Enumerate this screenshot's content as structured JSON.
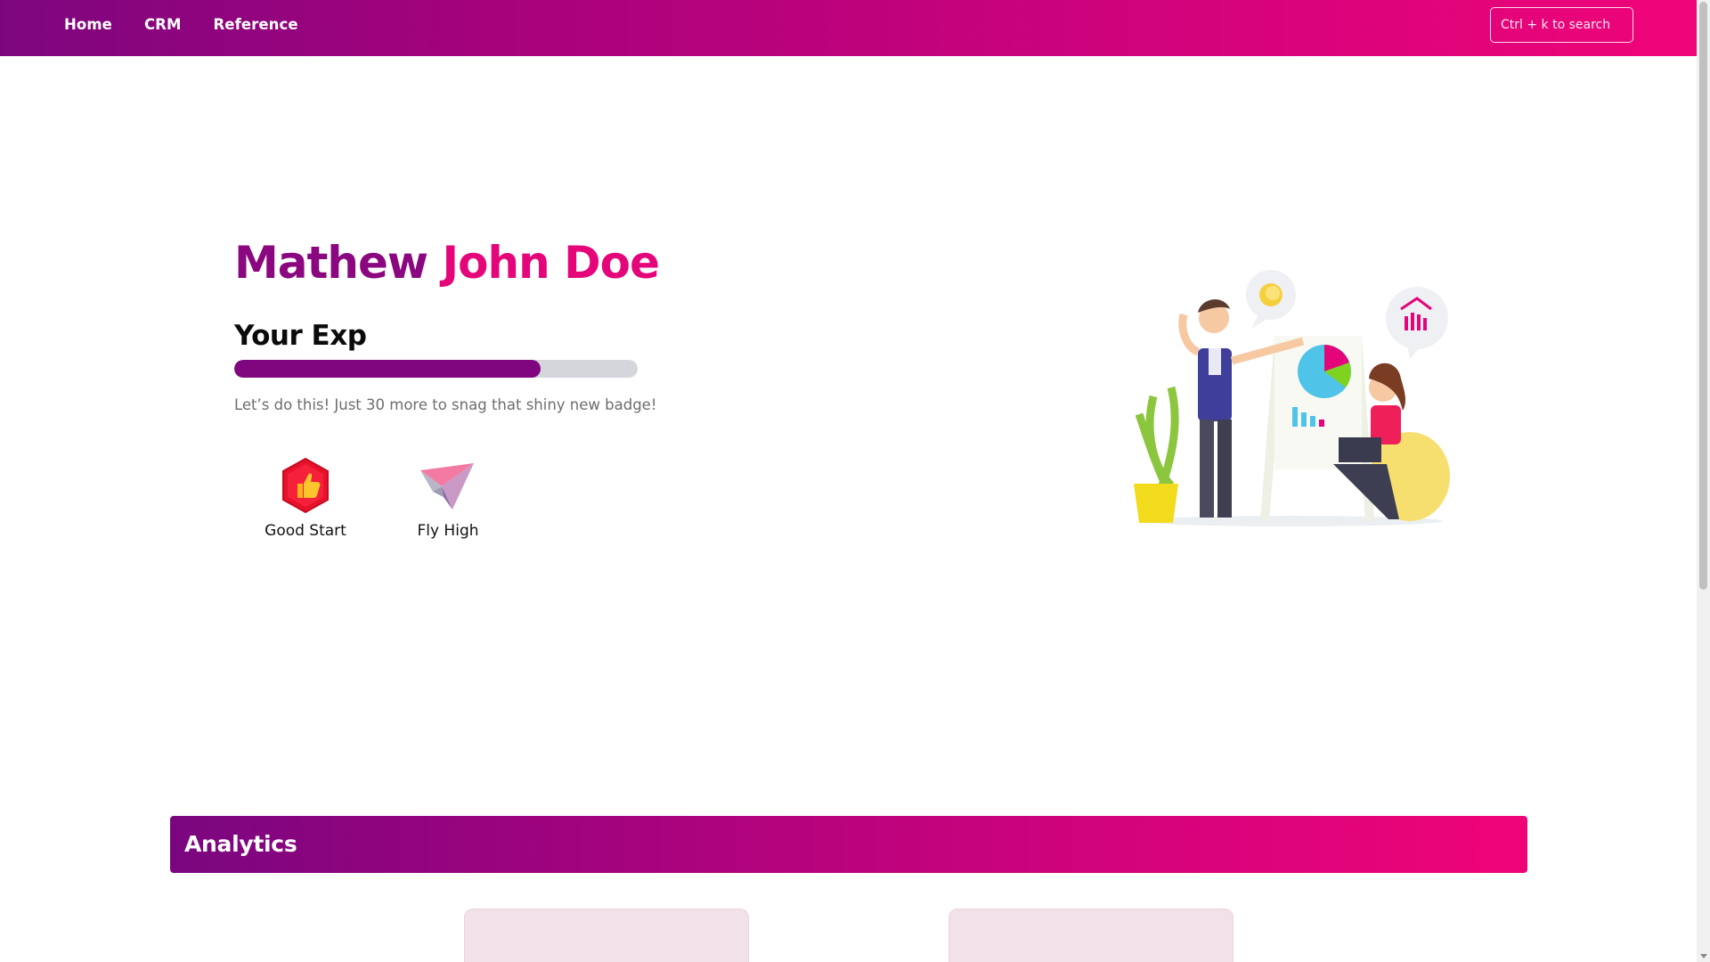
{
  "nav": {
    "items": [
      {
        "label": "Home"
      },
      {
        "label": "CRM"
      },
      {
        "label": "Reference"
      }
    ],
    "search_placeholder": "Ctrl + k to search"
  },
  "hero": {
    "first_name": "Mathew",
    "last_name": "John Doe",
    "exp_title": "Your Exp",
    "exp_progress_fraction": 0.76,
    "exp_message": "Let’s do this! Just 30 more to snag that shiny new badge!"
  },
  "badges": [
    {
      "label": "Good Start",
      "icon": "thumbs-up-hexagon-icon"
    },
    {
      "label": "Fly High",
      "icon": "paper-plane-icon"
    }
  ],
  "analytics": {
    "title": "Analytics"
  },
  "colors": {
    "brand_purple": "#800680",
    "brand_pink": "#e5057a",
    "progress_track": "#d5d5dc",
    "card_bg": "#f3e1e9"
  }
}
